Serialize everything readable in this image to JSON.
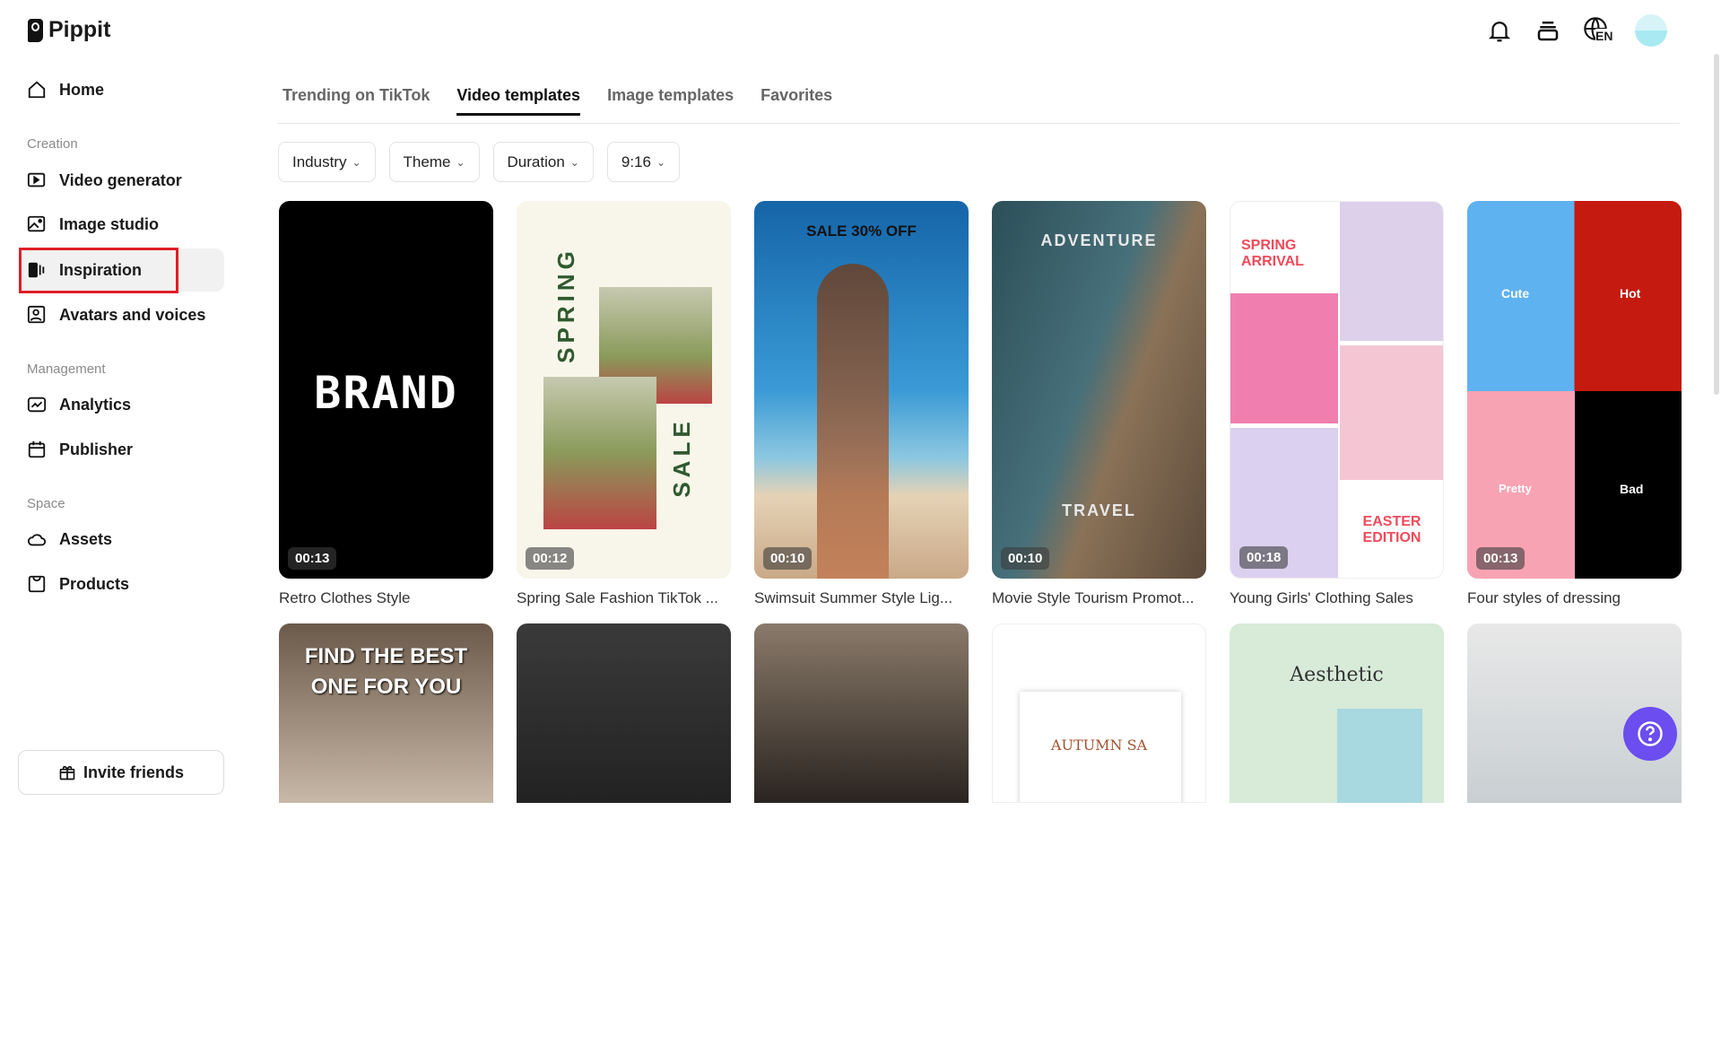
{
  "app": {
    "name": "Pippit"
  },
  "header": {
    "language": "EN"
  },
  "sidebar": {
    "home": "Home",
    "sections": [
      {
        "label": "Creation",
        "items": [
          "Video generator",
          "Image studio",
          "Inspiration",
          "Avatars and voices"
        ]
      },
      {
        "label": "Management",
        "items": [
          "Analytics",
          "Publisher"
        ]
      },
      {
        "label": "Space",
        "items": [
          "Assets",
          "Products"
        ]
      }
    ],
    "active": "Inspiration",
    "invite": "Invite friends"
  },
  "tabs": [
    "Trending on TikTok",
    "Video templates",
    "Image templates",
    "Favorites"
  ],
  "active_tab": "Video templates",
  "filters": [
    "Industry",
    "Theme",
    "Duration",
    "9:16"
  ],
  "templates": [
    {
      "title": "Retro Clothes Style",
      "duration": "00:13",
      "text": [
        "BRAND"
      ]
    },
    {
      "title": "Spring Sale Fashion TikTok ...",
      "duration": "00:12",
      "text": [
        "SPRING",
        "SALE"
      ]
    },
    {
      "title": "Swimsuit Summer Style Lig...",
      "duration": "00:10",
      "text": [
        "SALE 30% OFF"
      ]
    },
    {
      "title": "Movie Style Tourism Promot...",
      "duration": "00:10",
      "text": [
        "ADVENTURE",
        "TRAVEL"
      ]
    },
    {
      "title": "Young Girls' Clothing Sales",
      "duration": "00:18",
      "text": [
        "SPRING ARRIVAL",
        "EASTER EDITION"
      ]
    },
    {
      "title": "Four styles of dressing",
      "duration": "00:13",
      "text": [
        "Cute",
        "Hot",
        "Pretty",
        "Bad"
      ]
    }
  ],
  "templates_row2": [
    {
      "text": [
        "FIND THE BEST ONE FOR YOU"
      ]
    },
    {
      "text": []
    },
    {
      "text": []
    },
    {
      "text": [
        "AUTUMN SA"
      ]
    },
    {
      "text": [
        "Aesthetic"
      ]
    },
    {
      "text": []
    }
  ]
}
